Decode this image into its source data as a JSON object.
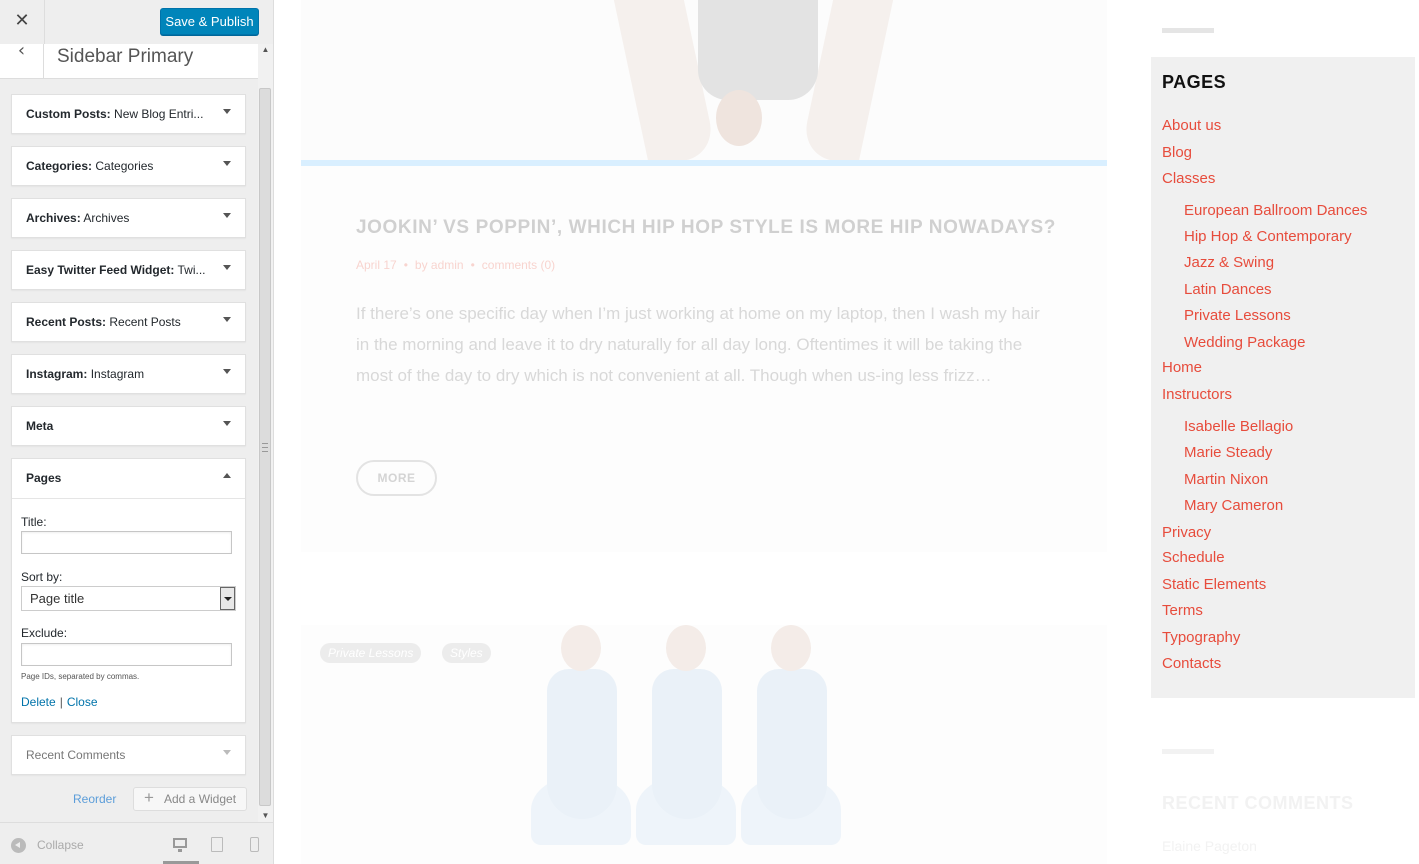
{
  "customizer": {
    "close_glyph": "✕",
    "save_button": "Save & Publish",
    "back_glyph": "‹",
    "section_title": "Sidebar Primary",
    "widgets": [
      {
        "type": "Custom Posts:",
        "name": "New Blog Entri..."
      },
      {
        "type": "Categories:",
        "name": "Categories"
      },
      {
        "type": "Archives:",
        "name": "Archives"
      },
      {
        "type": "Easy Twitter Feed Widget:",
        "name": "Twi..."
      },
      {
        "type": "Recent Posts:",
        "name": "Recent Posts"
      },
      {
        "type": "Instagram:",
        "name": "Instagram"
      },
      {
        "type": "Meta",
        "name": ""
      },
      {
        "type": "Pages",
        "name": ""
      },
      {
        "type": "Recent Comments",
        "name": ""
      }
    ],
    "pages_form": {
      "title_label": "Title:",
      "title_value": "",
      "sortby_label": "Sort by:",
      "sortby_value": "Page title",
      "exclude_label": "Exclude:",
      "exclude_value": "",
      "exclude_hint": "Page IDs, separated by commas.",
      "delete_link": "Delete",
      "separator": "|",
      "close_link": "Close"
    },
    "reorder_link": "Reorder",
    "add_widget_button": "Add a Widget",
    "collapse_label": "Collapse"
  },
  "preview": {
    "post": {
      "title": "JOOKIN’ VS POPPIN’, WHICH HIP HOP STYLE IS MORE HIP NOWADAYS?",
      "date": "April 17",
      "author": "by admin",
      "comments": "comments (0)",
      "excerpt": "If there’s one specific day when I’m just working at home on my laptop, then I wash my hair in the morning and leave it to dry naturally for all day long. Oftentimes it will be taking the most of the day to dry which is not convenient at all. Though when us-ing less frizz…",
      "more_button": "MORE"
    },
    "post2_tags": [
      "Private Lessons",
      "Styles"
    ],
    "pages_widget": {
      "title": "PAGES",
      "links": [
        {
          "label": "About us",
          "level": 0
        },
        {
          "label": "Blog",
          "level": 0
        },
        {
          "label": "Classes",
          "level": 0
        },
        {
          "label": "European Ballroom Dances",
          "level": 1
        },
        {
          "label": "Hip Hop & Contemporary",
          "level": 1
        },
        {
          "label": "Jazz & Swing",
          "level": 1
        },
        {
          "label": "Latin Dances",
          "level": 1
        },
        {
          "label": "Private Lessons",
          "level": 1
        },
        {
          "label": "Wedding Package",
          "level": 1
        },
        {
          "label": "Home",
          "level": 0
        },
        {
          "label": "Instructors",
          "level": 0
        },
        {
          "label": "Isabelle Bellagio",
          "level": 1
        },
        {
          "label": "Marie Steady",
          "level": 1
        },
        {
          "label": "Martin Nixon",
          "level": 1
        },
        {
          "label": "Mary Cameron",
          "level": 1
        },
        {
          "label": "Privacy",
          "level": 0
        },
        {
          "label": "Schedule",
          "level": 0
        },
        {
          "label": "Static Elements",
          "level": 0
        },
        {
          "label": "Terms",
          "level": 0
        },
        {
          "label": "Typography",
          "level": 0
        },
        {
          "label": "Contacts",
          "level": 0
        }
      ]
    },
    "recent_comments": {
      "title": "RECENT COMMENTS",
      "first_item": "Elaine Pageton"
    }
  },
  "colors": {
    "accent": "#0085ba",
    "link_red": "#e74c3c",
    "admin_link": "#0073aa"
  }
}
